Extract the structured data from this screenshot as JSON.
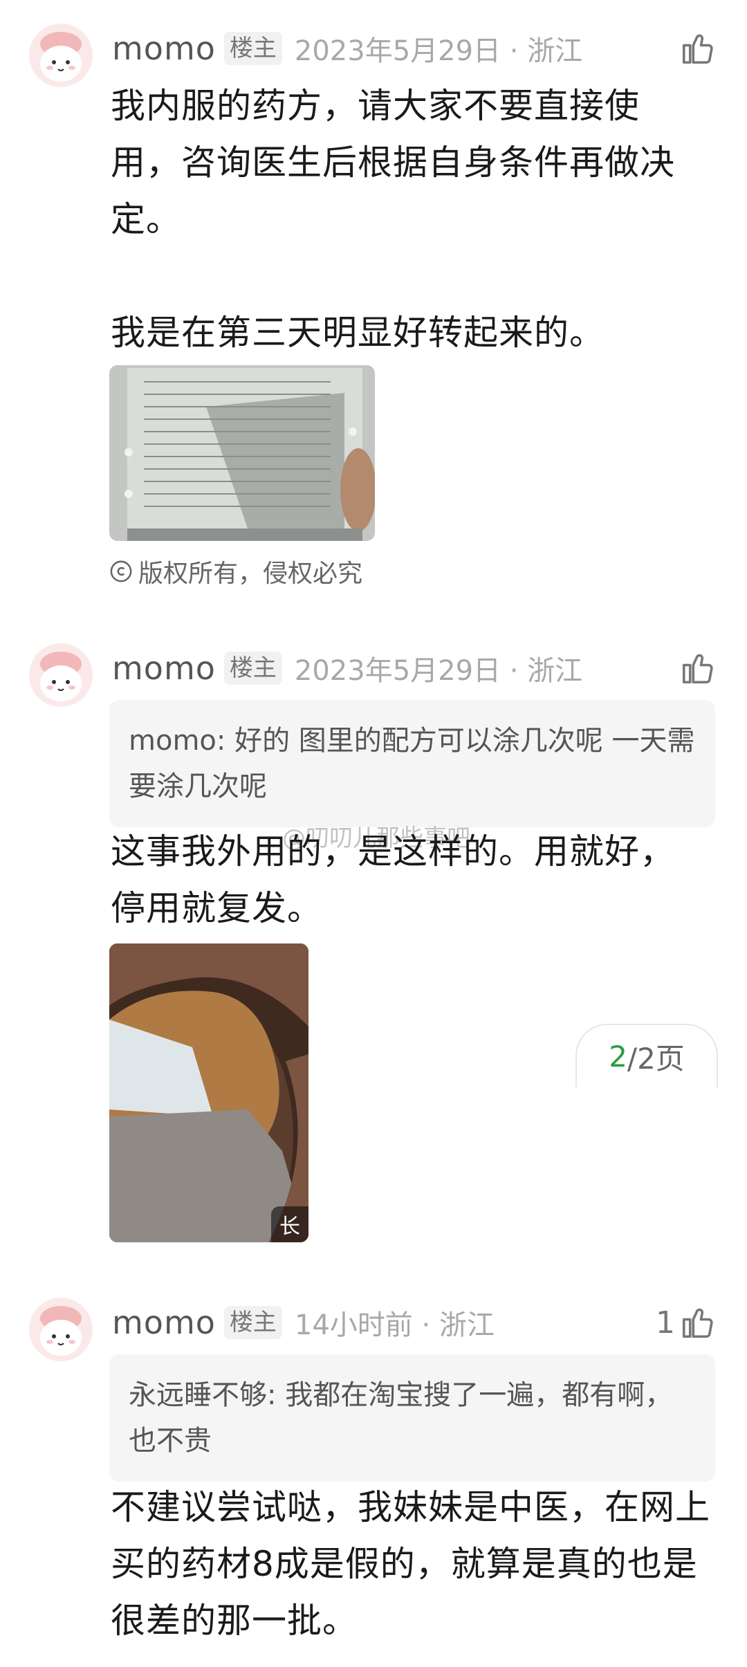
{
  "comments": [
    {
      "author": "momo",
      "badge": "楼主",
      "time": "2023年5月29日 · 浙江",
      "likes": "",
      "text": "我内服的药方，请大家不要直接使用，咨询医生后根据自身条件再做决定。\n\n我是在第三天明显好转起来的。",
      "copyright": "版权所有，侵权必究",
      "icons": [
        "avatar-icon",
        "thumb-up-icon",
        "copyright-icon"
      ]
    },
    {
      "author": "momo",
      "badge": "楼主",
      "time": "2023年5月29日 · 浙江",
      "likes": "",
      "quote": "momo: 好的 图里的配方可以涂几次呢 一天需要涂几次呢",
      "text": "这事我外用的，是这样的。用就好，停用就复发。",
      "image_badge": "长"
    },
    {
      "author": "momo",
      "badge": "楼主",
      "time": "14小时前 · 浙江",
      "likes": "1",
      "quote": "永远睡不够: 我都在淘宝搜了一遍，都有啊，也不贵",
      "text": "不建议尝试哒，我妹妹是中医，在网上买的药材8成是假的，就算是真的也是很差的那一批。"
    }
  ],
  "pager": {
    "current": "2",
    "rest": "/2页"
  },
  "watermark": "@叨叨儿那些事吧",
  "colors": {
    "accent_green": "#2a9d3c",
    "meta_gray": "#a8a8a8"
  }
}
